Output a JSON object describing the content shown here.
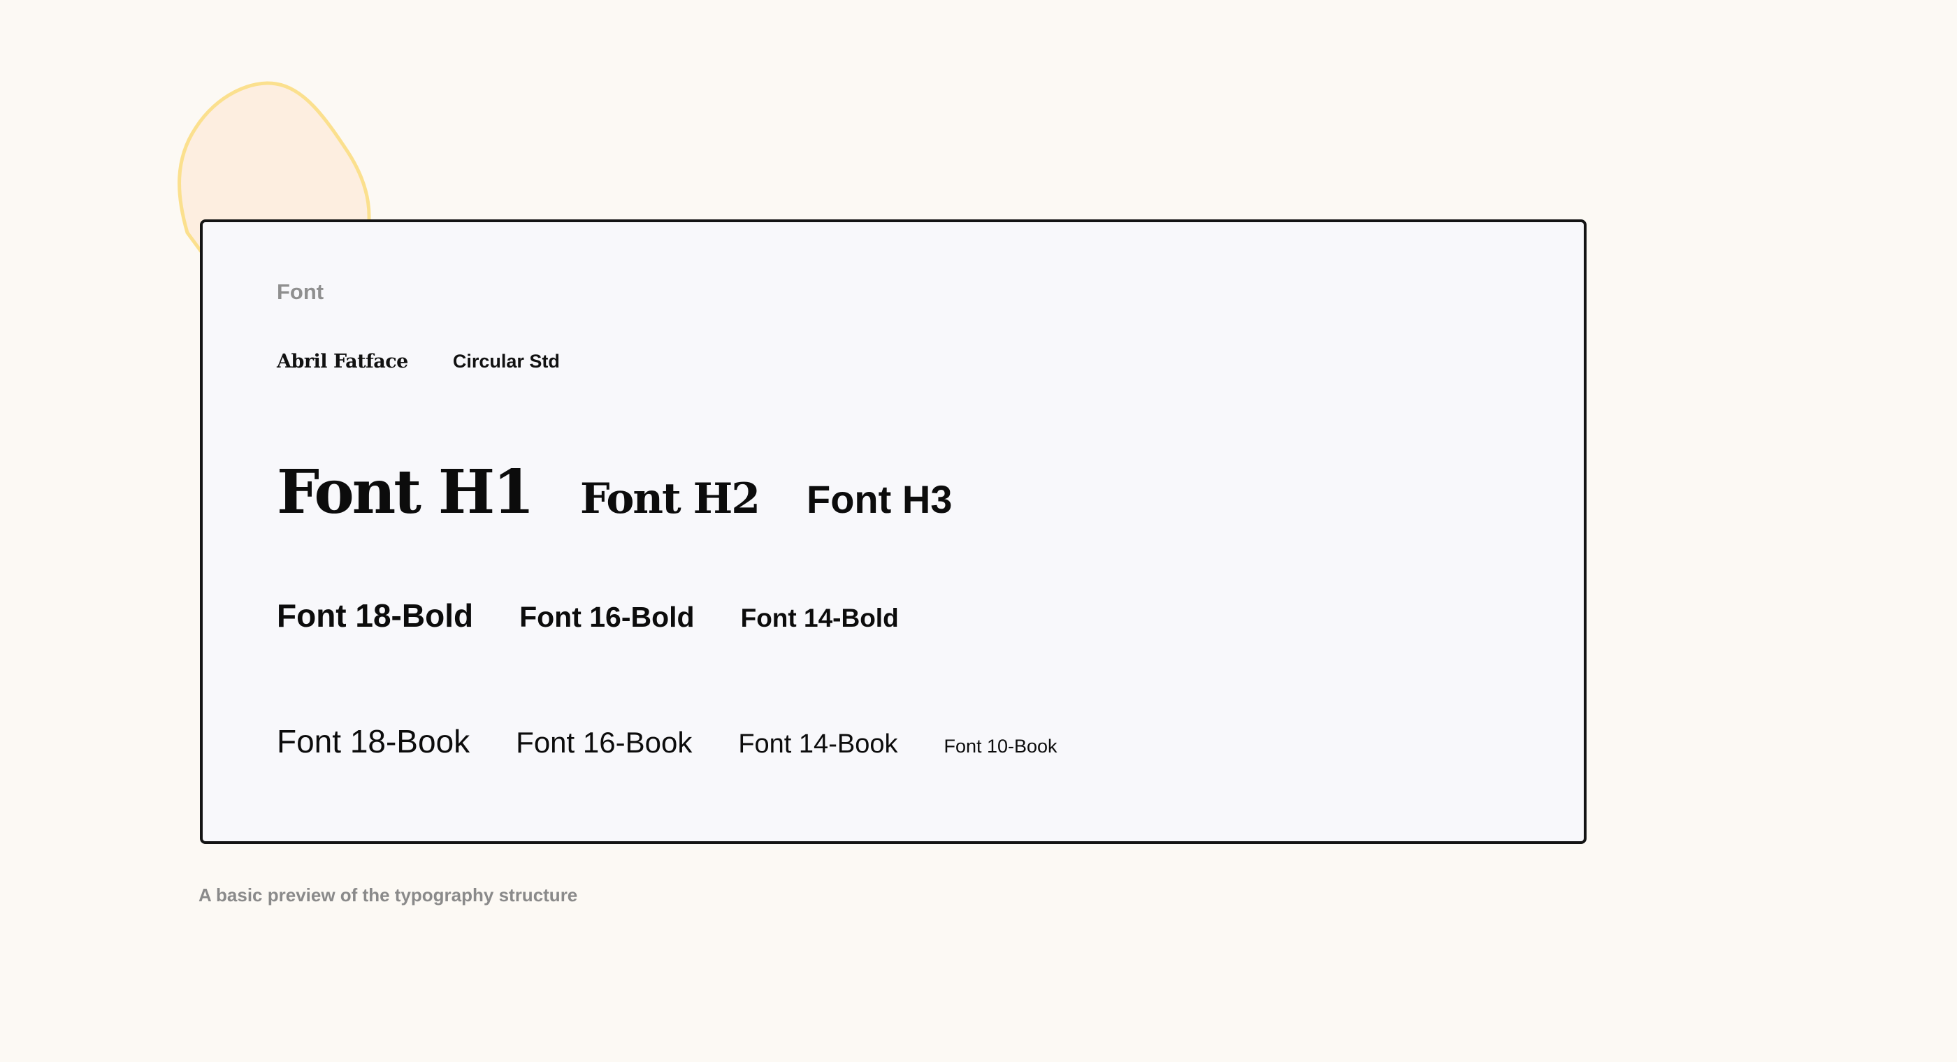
{
  "colors": {
    "background": "#fcf9f4",
    "card_background": "#f8f8fb",
    "card_border": "#141414",
    "blob_fill": "#fdeee0",
    "blob_stroke": "#fbe08e",
    "muted_text": "#8f8f8f"
  },
  "card": {
    "label": "Font",
    "families": [
      "Abril Fatface",
      "Circular Std"
    ],
    "headings": [
      "Font H1",
      "Font H2",
      "Font H3"
    ],
    "bold_sizes": [
      "Font 18-Bold",
      "Font 16-Bold",
      "Font 14-Bold"
    ],
    "book_sizes": [
      "Font 18-Book",
      "Font 16-Book",
      "Font 14-Book",
      "Font 10-Book"
    ]
  },
  "caption": "A basic preview of the typography structure"
}
